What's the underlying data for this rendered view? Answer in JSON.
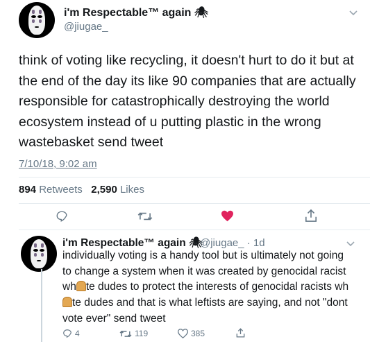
{
  "tweet": {
    "display_name": "i'm Respectable™ again",
    "name_emoji": "🕷",
    "handle": "@jiugae_",
    "text": "think of voting like recycling, it doesn't hurt to do it but at the end of the day its like 90 companies that are actually responsible for catastrophically destroying the world ecosystem instead of u putting plastic in the wrong wastebasket send tweet",
    "timestamp": "7/10/18, 9:02 am",
    "retweets_count": "894",
    "retweets_label": "Retweets",
    "likes_count": "2,590",
    "likes_label": "Likes",
    "liked": true
  },
  "reply": {
    "display_name": "i'm Respectable™ again",
    "name_emoji": "🕷",
    "handle_time": "@jiugae_ · 1d",
    "text_part1": "individually voting is a handy tool but is ultimately not going to change a system when it was created by genocidal racist wh",
    "text_part2": "te dudes to protect the interests of genocidal racists wh",
    "text_part3": "te dudes and that is what leftists are saying, and not \"dont vote ever\" send tweet",
    "reply_count": "4",
    "retweet_count": "119",
    "like_count": "385"
  },
  "colors": {
    "like_active": "#e0245e",
    "muted": "#657786",
    "text": "#14171a",
    "divider": "#e6ecf0"
  },
  "icons": [
    "chevron-down-icon",
    "reply-icon",
    "retweet-icon",
    "heart-icon",
    "share-icon",
    "spider-emoji",
    "bread-emoji"
  ]
}
